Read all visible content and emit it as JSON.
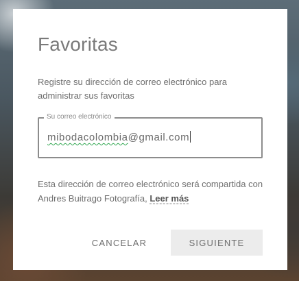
{
  "modal": {
    "title": "Favoritas",
    "description": "Registre su dirección de correo electrónico para administrar sus favoritas",
    "email_field": {
      "label": "Su correo electrónico",
      "value_part1": "mibodacolombia",
      "value_part2": "@gmail.com"
    },
    "notice": {
      "text": "Esta dirección de correo electrónico será compartida con Andres Buitrago Fotografía, ",
      "link_label": "Leer más"
    },
    "buttons": {
      "cancel_label": "CANCELAR",
      "next_label": "SIGUIENTE"
    }
  },
  "colors": {
    "title": "#7a7a7a",
    "text": "#6e6e6e",
    "field_border": "#8c8c8c",
    "next_button_bg": "#ececec",
    "spellcheck_underline": "#34a853"
  }
}
